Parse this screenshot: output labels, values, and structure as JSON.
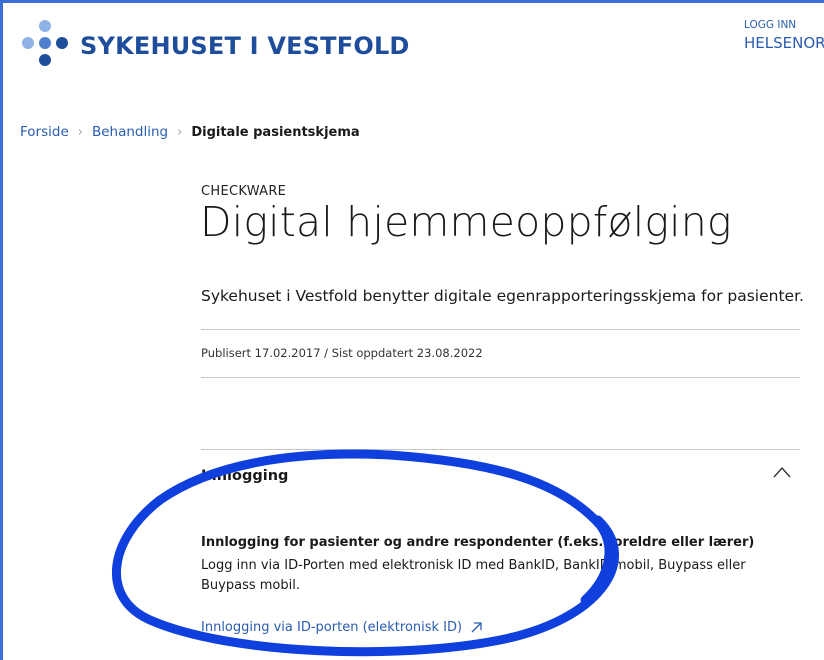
{
  "header": {
    "brand": "SYKEHUSET I VESTFOLD",
    "login_label": "LOGG INN",
    "helsenorge_label": "HELSENOR"
  },
  "breadcrumb": {
    "items": [
      "Forside",
      "Behandling"
    ],
    "current": "Digitale pasientskjema"
  },
  "article": {
    "kicker": "CHECKWARE",
    "title": "Digital hjemmeoppfølging",
    "ingress": "Sykehuset i Vestfold benytter digitale egenrapporteringsskjema for pasienter.",
    "meta": "Publisert 17.02.2017 / Sist oppdatert 23.08.2022"
  },
  "accordion": {
    "title": "Innlogging",
    "expanded": true,
    "subheading": "Innlogging for pasienter og andre respondenter (f.eks. foreldre eller lærer)",
    "body": "Logg inn via ID-Porten med elektronisk ID med BankID, BankID mobil, Buypass eller Buypass mobil.",
    "link_label": "Innlogging via ID-porten (elektronisk ID)"
  },
  "colors": {
    "brand": "#1e4d9c",
    "link": "#2a5db0",
    "logo_light": "#8fb2e6",
    "annotation": "#0f3fdc"
  },
  "icons": [
    "logo-dots",
    "chevron-right-icon",
    "chevron-up-icon",
    "external-link-icon"
  ]
}
